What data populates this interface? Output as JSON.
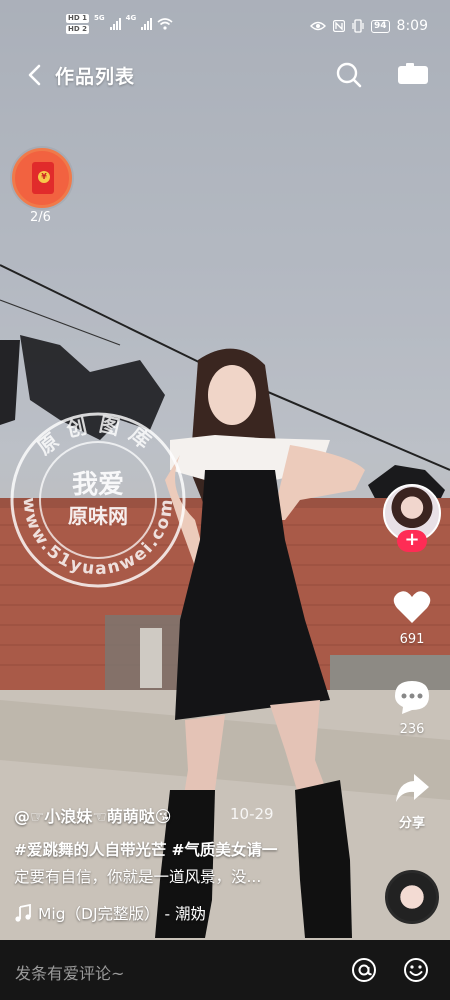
{
  "status_bar": {
    "sim1": "HD 1",
    "sim2": "HD 2",
    "net1": "5G",
    "net2": "4G",
    "battery": "94",
    "time": "8:09"
  },
  "header": {
    "title": "作品列表"
  },
  "red_packet": {
    "progress": "2/6"
  },
  "actions": {
    "likes": "691",
    "comments": "236",
    "share_label": "分享"
  },
  "post": {
    "author": "@☞小浪妹☜萌萌哒😘",
    "date": "10-29",
    "hashtag1": "#爱跳舞的人自带光芒",
    "hashtag2": "#气质美女请一",
    "desc_line2": "定要有自信，你就是一道风景，没...",
    "music": "Mig（DJ完整版） - 潮妫"
  },
  "watermark": {
    "top_text": "原创图库",
    "line1": "我爱",
    "line2": "原味网",
    "site": "www.51yuanwei.com"
  },
  "comment_bar": {
    "placeholder": "发条有爱评论~"
  },
  "colors": {
    "accent": "#fe2c55",
    "bottom_bar": "#161616"
  }
}
